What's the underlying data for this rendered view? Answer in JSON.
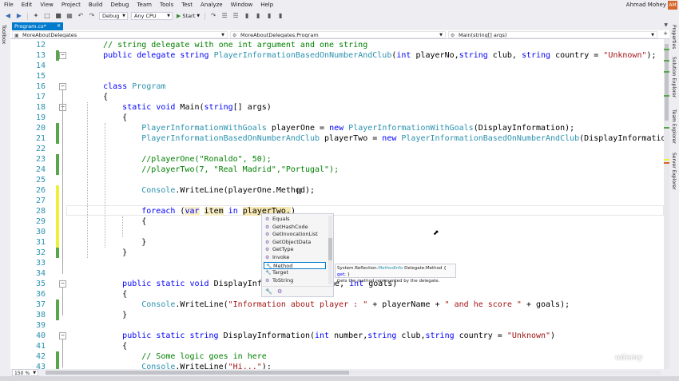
{
  "menu": {
    "items": [
      "File",
      "Edit",
      "View",
      "Project",
      "Build",
      "Debug",
      "Team",
      "Tools",
      "Test",
      "Analyze",
      "Window",
      "Help"
    ],
    "user": "Ahmad Mohey",
    "avatar": "AM"
  },
  "toolbar": {
    "config": "Debug",
    "platform": "Any CPU",
    "start_label": "Start"
  },
  "side": {
    "toolbox": "Toolbox",
    "right_panels": [
      "Properties",
      "Solution Explorer",
      "Team Explorer",
      "Server Explorer"
    ]
  },
  "tab": {
    "label": "Program.cs*"
  },
  "navbar": {
    "project": "MoreAboutDelegates",
    "class": "MoreAboutDelegates.Program",
    "member": "Main(string[] args)"
  },
  "editor": {
    "lines": [
      {
        "n": "12",
        "chg": "",
        "tokens": [
          {
            "c": "cm",
            "t": "    // string delegate with one int argument and one string"
          }
        ]
      },
      {
        "n": "13",
        "chg": "green",
        "tokens": [
          {
            "c": "",
            "t": "    "
          },
          {
            "c": "kw",
            "t": "public delegate string"
          },
          {
            "c": "",
            "t": " "
          },
          {
            "c": "ty",
            "t": "PlayerInformationBasedOnNumberAndClub"
          },
          {
            "c": "",
            "t": "("
          },
          {
            "c": "kw",
            "t": "int"
          },
          {
            "c": "",
            "t": " playerNo,"
          },
          {
            "c": "kw",
            "t": "string"
          },
          {
            "c": "",
            "t": " club, "
          },
          {
            "c": "kw",
            "t": "string"
          },
          {
            "c": "",
            "t": " country = "
          },
          {
            "c": "st",
            "t": "\"Unknown\""
          },
          {
            "c": "",
            "t": ");"
          }
        ]
      },
      {
        "n": "14",
        "chg": "",
        "tokens": []
      },
      {
        "n": "15",
        "chg": "",
        "tokens": []
      },
      {
        "n": "16",
        "chg": "",
        "tokens": [
          {
            "c": "",
            "t": "    "
          },
          {
            "c": "kw",
            "t": "class"
          },
          {
            "c": "",
            "t": " "
          },
          {
            "c": "ty",
            "t": "Program"
          }
        ]
      },
      {
        "n": "17",
        "chg": "",
        "tokens": [
          {
            "c": "",
            "t": "    {"
          }
        ]
      },
      {
        "n": "18",
        "chg": "",
        "tokens": [
          {
            "c": "",
            "t": "        "
          },
          {
            "c": "kw",
            "t": "static void"
          },
          {
            "c": "",
            "t": " Main("
          },
          {
            "c": "kw",
            "t": "string"
          },
          {
            "c": "",
            "t": "[] args)"
          }
        ]
      },
      {
        "n": "19",
        "chg": "",
        "tokens": [
          {
            "c": "",
            "t": "        {"
          }
        ]
      },
      {
        "n": "20",
        "chg": "green",
        "tokens": [
          {
            "c": "",
            "t": "            "
          },
          {
            "c": "ty",
            "t": "PlayerInformationWithGoals"
          },
          {
            "c": "",
            "t": " playerOne = "
          },
          {
            "c": "kw",
            "t": "new"
          },
          {
            "c": "",
            "t": " "
          },
          {
            "c": "ty",
            "t": "PlayerInformationWithGoals"
          },
          {
            "c": "",
            "t": "(DisplayInformation);"
          }
        ]
      },
      {
        "n": "21",
        "chg": "green",
        "tokens": [
          {
            "c": "",
            "t": "            "
          },
          {
            "c": "ty",
            "t": "PlayerInformationBasedOnNumberAndClub"
          },
          {
            "c": "",
            "t": " playerTwo = "
          },
          {
            "c": "kw",
            "t": "new"
          },
          {
            "c": "",
            "t": " "
          },
          {
            "c": "ty",
            "t": "PlayerInformationBasedOnNumberAndClub"
          },
          {
            "c": "",
            "t": "(DisplayInformation);"
          }
        ]
      },
      {
        "n": "22",
        "chg": "",
        "tokens": []
      },
      {
        "n": "23",
        "chg": "green",
        "tokens": [
          {
            "c": "cm",
            "t": "            //playerOne(\"Ronaldo\", 50);"
          }
        ]
      },
      {
        "n": "24",
        "chg": "green",
        "tokens": [
          {
            "c": "cm",
            "t": "            //playerTwo(7, \"Real Madrid\",\"Portugal\");"
          }
        ]
      },
      {
        "n": "25",
        "chg": "",
        "tokens": []
      },
      {
        "n": "26",
        "chg": "yellow",
        "tokens": [
          {
            "c": "",
            "t": "            "
          },
          {
            "c": "ty",
            "t": "Console"
          },
          {
            "c": "",
            "t": ".WriteLine(playerOne.Method);"
          }
        ]
      },
      {
        "n": "27",
        "chg": "yellow",
        "tokens": []
      },
      {
        "n": "28",
        "chg": "yellow",
        "tokens": [
          {
            "c": "",
            "t": "            "
          },
          {
            "c": "kw",
            "t": "foreach"
          },
          {
            "c": "",
            "t": " ("
          },
          {
            "c": "kw hl",
            "t": "var"
          },
          {
            "c": "",
            "t": " "
          },
          {
            "c": "hl",
            "t": "item"
          },
          {
            "c": "",
            "t": " "
          },
          {
            "c": "kw",
            "t": "in"
          },
          {
            "c": "",
            "t": " "
          },
          {
            "c": "hlbox",
            "t": "playerTwo."
          },
          {
            "c": "",
            "t": ")"
          }
        ]
      },
      {
        "n": "29",
        "chg": "yellow",
        "tokens": [
          {
            "c": "",
            "t": "            {"
          }
        ]
      },
      {
        "n": "30",
        "chg": "yellow",
        "tokens": []
      },
      {
        "n": "31",
        "chg": "yellow",
        "tokens": [
          {
            "c": "",
            "t": "            }"
          }
        ]
      },
      {
        "n": "32",
        "chg": "green",
        "tokens": [
          {
            "c": "",
            "t": "        }"
          }
        ]
      },
      {
        "n": "33",
        "chg": "",
        "tokens": []
      },
      {
        "n": "34",
        "chg": "",
        "tokens": []
      },
      {
        "n": "35",
        "chg": "",
        "tokens": [
          {
            "c": "",
            "t": "        "
          },
          {
            "c": "kw",
            "t": "public static void"
          },
          {
            "c": "",
            "t": " DisplayInformati"
          }
        ]
      },
      {
        "n": "36",
        "chg": "",
        "tokens": [
          {
            "c": "",
            "t": "        {"
          }
        ]
      },
      {
        "n": "37",
        "chg": "green",
        "tokens": [
          {
            "c": "",
            "t": "            "
          },
          {
            "c": "ty",
            "t": "Console"
          },
          {
            "c": "",
            "t": ".WriteLine("
          },
          {
            "c": "st",
            "t": "\"Information about player : \""
          },
          {
            "c": "",
            "t": " + playerName + "
          },
          {
            "c": "st",
            "t": "\" and he score \""
          },
          {
            "c": "",
            "t": " + goals);"
          }
        ]
      },
      {
        "n": "38",
        "chg": "green",
        "tokens": [
          {
            "c": "",
            "t": "        }"
          }
        ]
      },
      {
        "n": "39",
        "chg": "",
        "tokens": []
      },
      {
        "n": "40",
        "chg": "",
        "tokens": [
          {
            "c": "",
            "t": "        "
          },
          {
            "c": "kw",
            "t": "public static string"
          },
          {
            "c": "",
            "t": " DisplayInformation("
          },
          {
            "c": "kw",
            "t": "int"
          },
          {
            "c": "",
            "t": " number,"
          },
          {
            "c": "kw",
            "t": "string"
          },
          {
            "c": "",
            "t": " club,"
          },
          {
            "c": "kw",
            "t": "string"
          },
          {
            "c": "",
            "t": " country = "
          },
          {
            "c": "st",
            "t": "\"Unknown\""
          },
          {
            "c": "",
            "t": ")"
          }
        ]
      },
      {
        "n": "41",
        "chg": "",
        "tokens": [
          {
            "c": "",
            "t": "        {"
          }
        ]
      },
      {
        "n": "42",
        "chg": "green",
        "tokens": [
          {
            "c": "cm",
            "t": "            // Some logic goes in here"
          }
        ]
      },
      {
        "n": "43",
        "chg": "green",
        "tokens": [
          {
            "c": "",
            "t": "            "
          },
          {
            "c": "ty",
            "t": "Console"
          },
          {
            "c": "",
            "t": ".WriteLine("
          },
          {
            "c": "st",
            "t": "\"Hi...\""
          },
          {
            "c": "",
            "t": ");"
          }
        ]
      }
    ],
    "line35_tail": [
      {
        "c": "",
        "t": "Name, "
      },
      {
        "c": "kw",
        "t": "int"
      },
      {
        "c": "",
        "t": " goals)"
      }
    ]
  },
  "intellisense": {
    "items": [
      {
        "label": "Equals",
        "icon": "method-icon"
      },
      {
        "label": "GetHashCode",
        "icon": "method-icon"
      },
      {
        "label": "GetInvocationList",
        "icon": "method-icon"
      },
      {
        "label": "GetObjectData",
        "icon": "method-icon"
      },
      {
        "label": "GetType",
        "icon": "method-icon"
      },
      {
        "label": "Invoke",
        "icon": "method-icon"
      },
      {
        "label": "Method",
        "icon": "property-icon",
        "selected": true
      },
      {
        "label": "Target",
        "icon": "property-icon"
      },
      {
        "label": "ToString",
        "icon": "method-icon"
      }
    ]
  },
  "tooltip": {
    "sig_prefix": "System.Reflection.",
    "sig_type": "MethodInfo",
    "sig_mid": " Delegate.Method { ",
    "sig_kw": "get",
    "sig_end": "; }",
    "description": "Gets the method represented by the delegate."
  },
  "status": {
    "zoom": "150 %"
  },
  "watermark": "udemy"
}
